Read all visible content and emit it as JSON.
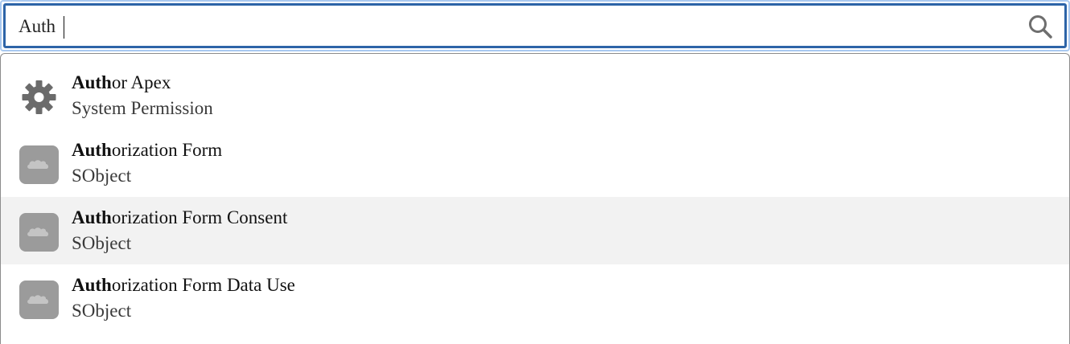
{
  "search": {
    "value": "Auth",
    "search_icon": "search-icon"
  },
  "results": [
    {
      "match": "Auth",
      "rest": "or Apex",
      "type": "System Permission",
      "icon": "gear-icon",
      "highlighted": false
    },
    {
      "match": "Auth",
      "rest": "orization Form",
      "type": "SObject",
      "icon": "salesforce-cloud-icon",
      "highlighted": false
    },
    {
      "match": "Auth",
      "rest": "orization Form Consent",
      "type": "SObject",
      "icon": "salesforce-cloud-icon",
      "highlighted": true
    },
    {
      "match": "Auth",
      "rest": "orization Form Data Use",
      "type": "SObject",
      "icon": "salesforce-cloud-icon",
      "highlighted": false
    }
  ],
  "colors": {
    "focus_border": "#2d64a8",
    "focus_ring": "#a9c9f0",
    "highlight_row": "#f2f2f2",
    "icon_gray": "#9b9b9b"
  }
}
